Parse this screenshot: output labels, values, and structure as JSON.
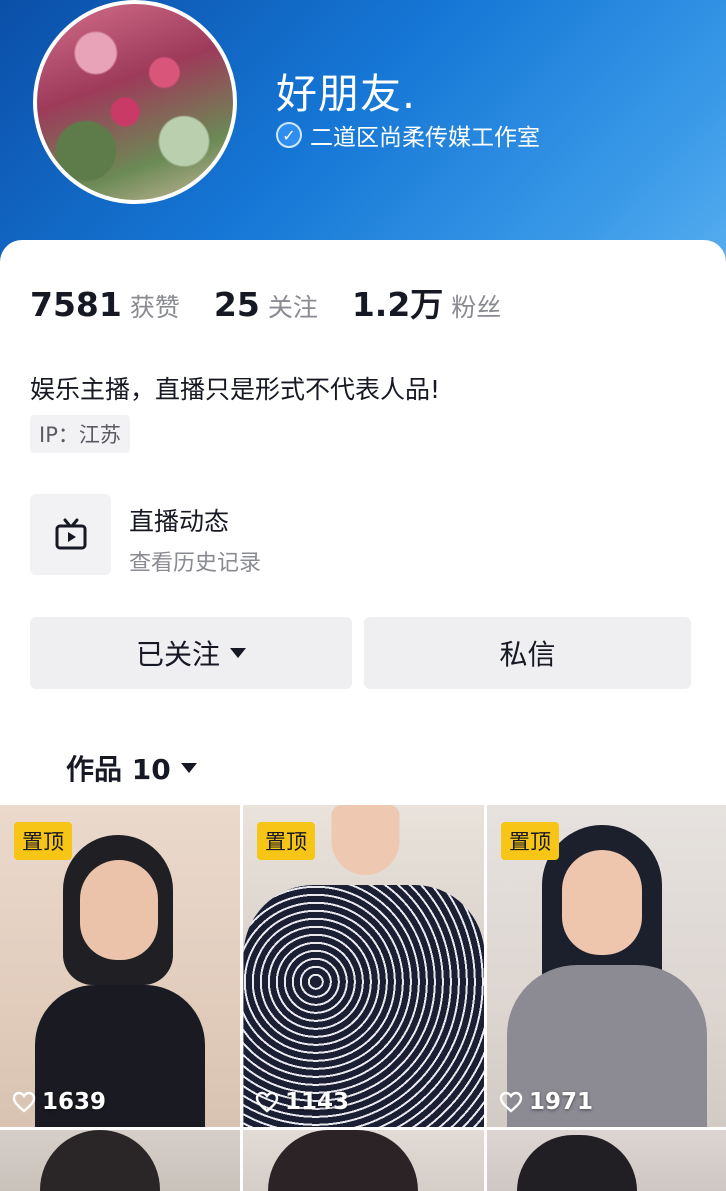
{
  "profile": {
    "nickname": "好朋友.",
    "verified_org": "二道区尚柔传媒工作室"
  },
  "stats": [
    {
      "num": "7581",
      "label": "获赞"
    },
    {
      "num": "25",
      "label": "关注"
    },
    {
      "num": "1.2万",
      "label": "粉丝"
    }
  ],
  "bio": "娱乐主播，直播只是形式不代表人品!",
  "ip": "IP：江苏",
  "live": {
    "title": "直播动态",
    "subtitle": "查看历史记录"
  },
  "actions": {
    "follow_label": "已关注",
    "message_label": "私信"
  },
  "works": {
    "tab_label": "作品 10",
    "items": [
      {
        "pinned_label": "置顶",
        "likes": "1639"
      },
      {
        "pinned_label": "置顶",
        "likes": "1143"
      },
      {
        "pinned_label": "置顶",
        "likes": "1971"
      }
    ]
  },
  "colors": {
    "header_blue": "#1677d6",
    "pin_yellow": "#f6c515",
    "verify_blue": "#2f8fef"
  },
  "icons": [
    "verified-check-icon",
    "tv-icon",
    "caret-down-icon",
    "heart-icon"
  ]
}
